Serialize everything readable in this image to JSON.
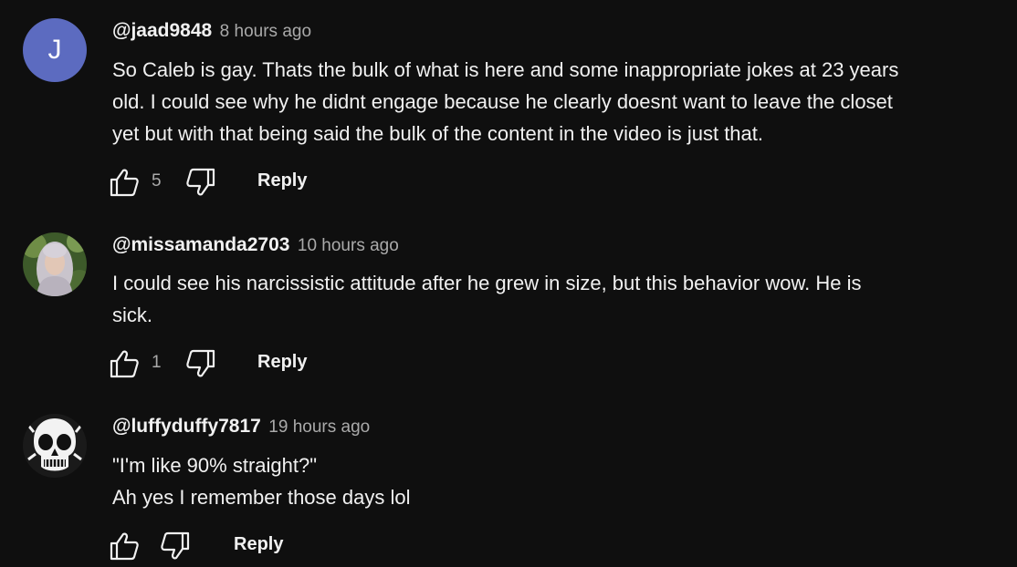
{
  "comments": [
    {
      "handle": "@jaad9848",
      "time": "8 hours ago",
      "avatar_letter": "J",
      "lines": [
        "So Caleb is gay. Thats the bulk of what is here and some inappropriate jokes at 23 years",
        "old. I could see why he didnt engage because he clearly doesnt want to leave the closet",
        "yet but with that being said the bulk of the content in the video is just that."
      ],
      "likes": "5",
      "reply_label": "Reply"
    },
    {
      "handle": "@missamanda2703",
      "time": "10 hours ago",
      "lines": [
        "I could see his narcissistic attitude after he grew in size, but this behavior wow. He is",
        "sick."
      ],
      "likes": "1",
      "reply_label": "Reply"
    },
    {
      "handle": "@luffyduffy7817",
      "time": "19 hours ago",
      "lines": [
        "\"I'm like 90% straight?\"",
        "Ah yes I remember those days lol"
      ],
      "likes": "",
      "reply_label": "Reply"
    }
  ],
  "colors": {
    "background": "#0f0f0f",
    "text_primary": "#f1f1f1",
    "text_secondary": "#aaaaaa",
    "avatar_j": "#5c6bc0"
  },
  "icons": {
    "like": "thumb-up-icon",
    "dislike": "thumb-down-icon"
  }
}
